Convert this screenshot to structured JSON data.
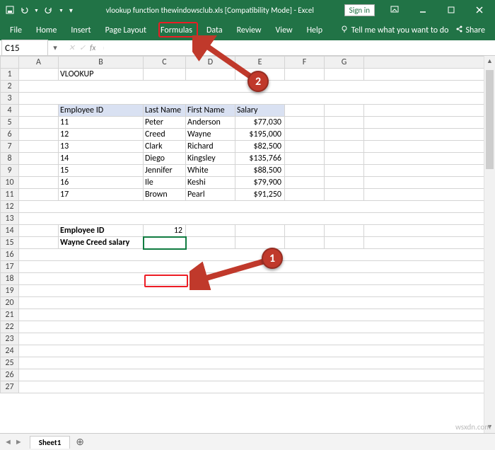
{
  "titlebar": {
    "title": "vlookup function thewindowsclub.xls  [Compatibility Mode]  -  Excel",
    "signin": "Sign in"
  },
  "tabs": {
    "file": "File",
    "home": "Home",
    "insert": "Insert",
    "pagelayout": "Page Layout",
    "formulas": "Formulas",
    "data": "Data",
    "review": "Review",
    "view": "View",
    "help": "Help",
    "tellme": "Tell me what you want to do",
    "share": "Share"
  },
  "fbar": {
    "namebox": "C15",
    "fx": "fx"
  },
  "cols": [
    "A",
    "B",
    "C",
    "D",
    "E",
    "F",
    "G",
    ""
  ],
  "rows": [
    "1",
    "2",
    "3",
    "4",
    "5",
    "6",
    "7",
    "8",
    "9",
    "10",
    "11",
    "12",
    "13",
    "14",
    "15",
    "16",
    "17",
    "18",
    "19",
    "20",
    "21",
    "22",
    "23",
    "24",
    "25",
    "26",
    "27"
  ],
  "cells": {
    "B1": "VLOOKUP",
    "B4": "Employee ID",
    "C4": "Last Name",
    "D4": "First Name",
    "E4": "Salary",
    "B5": "11",
    "C5": "Peter",
    "D5": "Anderson",
    "E5": "$77,030",
    "B6": "12",
    "C6": "Creed",
    "D6": "Wayne",
    "E6": "$195,000",
    "B7": "13",
    "C7": "Clark",
    "D7": "Richard",
    "E7": "$82,500",
    "B8": "14",
    "C8": "Diego",
    "D8": "Kingsley",
    "E8": "$135,766",
    "B9": "15",
    "C9": "Jennifer",
    "D9": "White",
    "E9": "$88,500",
    "B10": "16",
    "C10": "Ile",
    "D10": "Keshi",
    "E10": "$79,900",
    "B11": "17",
    "C11": "Brown",
    "D11": "Pearl",
    "E11": "$91,250",
    "B14": "Employee ID",
    "C14": "12",
    "B15": "Wayne Creed salary"
  },
  "sheet": {
    "name": "Sheet1"
  },
  "watermark": "wsxdn.com",
  "badges": {
    "one": "1",
    "two": "2"
  }
}
